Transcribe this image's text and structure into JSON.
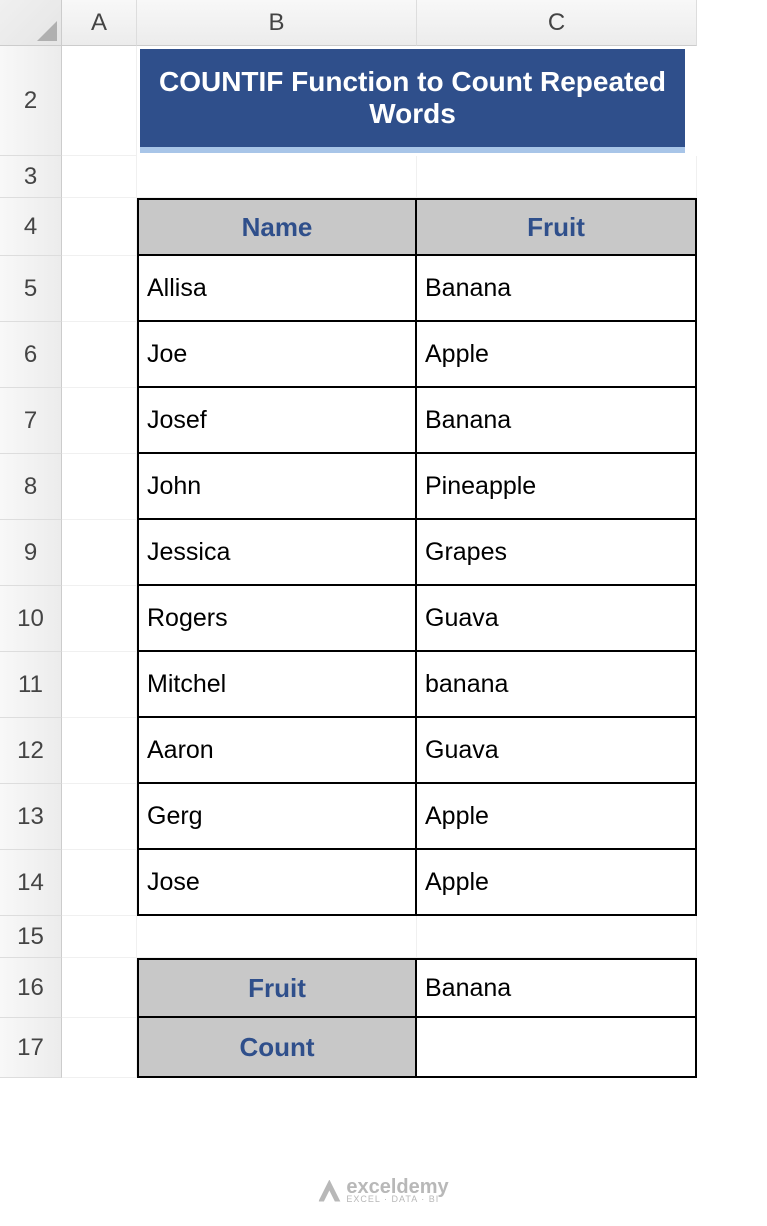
{
  "columns": [
    "A",
    "B",
    "C"
  ],
  "rows": [
    "2",
    "3",
    "4",
    "5",
    "6",
    "7",
    "8",
    "9",
    "10",
    "11",
    "12",
    "13",
    "14",
    "15",
    "16",
    "17"
  ],
  "title": "COUNTIF Function to Count Repeated Words",
  "table": {
    "headers": {
      "name": "Name",
      "fruit": "Fruit"
    },
    "rows": [
      {
        "name": "Allisa",
        "fruit": "Banana"
      },
      {
        "name": "Joe",
        "fruit": "Apple"
      },
      {
        "name": "Josef",
        "fruit": "Banana"
      },
      {
        "name": "John",
        "fruit": "Pineapple"
      },
      {
        "name": "Jessica",
        "fruit": "Grapes"
      },
      {
        "name": "Rogers",
        "fruit": "Guava"
      },
      {
        "name": "Mitchel",
        "fruit": "banana"
      },
      {
        "name": "Aaron",
        "fruit": "Guava"
      },
      {
        "name": "Gerg",
        "fruit": "Apple"
      },
      {
        "name": "Jose",
        "fruit": "Apple"
      }
    ]
  },
  "summary": {
    "fruit_label": "Fruit",
    "fruit_value": "Banana",
    "count_label": "Count",
    "count_value": ""
  },
  "watermark": {
    "name": "exceldemy",
    "tagline": "EXCEL · DATA · BI"
  }
}
